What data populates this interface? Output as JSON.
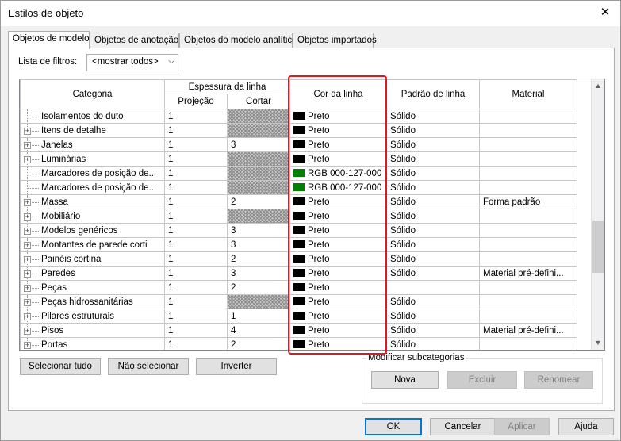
{
  "window": {
    "title": "Estilos de objeto",
    "close_glyph": "✕"
  },
  "tabs": [
    {
      "label": "Objetos de modelo",
      "active": true
    },
    {
      "label": "Objetos de anotação",
      "active": false
    },
    {
      "label": "Objetos do modelo analítico",
      "active": false
    },
    {
      "label": "Objetos importados",
      "active": false
    }
  ],
  "filter": {
    "label": "Lista de filtros:",
    "value": "<mostrar todos>"
  },
  "columns": {
    "category": "Categoria",
    "line_weight": "Espessura da linha",
    "projection": "Projeção",
    "cut": "Cortar",
    "line_color": "Cor da linha",
    "line_pattern": "Padrão de linha",
    "material": "Material"
  },
  "colors": {
    "black": "#000000",
    "green": "#007f00",
    "highlight": "#e4161d"
  },
  "rows": [
    {
      "category": "Isolamentos do duto",
      "expand": false,
      "projection": "1",
      "cut": "",
      "cut_hatched": true,
      "color_label": "Preto",
      "color": "#000000",
      "pattern": "Sólido",
      "material": ""
    },
    {
      "category": "Itens de detalhe",
      "expand": true,
      "projection": "1",
      "cut": "",
      "cut_hatched": true,
      "color_label": "Preto",
      "color": "#000000",
      "pattern": "Sólido",
      "material": ""
    },
    {
      "category": "Janelas",
      "expand": true,
      "projection": "1",
      "cut": "3",
      "cut_hatched": false,
      "color_label": "Preto",
      "color": "#000000",
      "pattern": "Sólido",
      "material": ""
    },
    {
      "category": "Luminárias",
      "expand": true,
      "projection": "1",
      "cut": "",
      "cut_hatched": true,
      "color_label": "Preto",
      "color": "#000000",
      "pattern": "Sólido",
      "material": ""
    },
    {
      "category": "Marcadores de posição de...",
      "expand": false,
      "projection": "1",
      "cut": "",
      "cut_hatched": true,
      "color_label": "RGB 000-127-000",
      "color": "#007f00",
      "pattern": "Sólido",
      "material": ""
    },
    {
      "category": "Marcadores de posição de...",
      "expand": false,
      "projection": "1",
      "cut": "",
      "cut_hatched": true,
      "color_label": "RGB 000-127-000",
      "color": "#007f00",
      "pattern": "Sólido",
      "material": ""
    },
    {
      "category": "Massa",
      "expand": true,
      "projection": "1",
      "cut": "2",
      "cut_hatched": false,
      "color_label": "Preto",
      "color": "#000000",
      "pattern": "Sólido",
      "material": "Forma padrão"
    },
    {
      "category": "Mobiliário",
      "expand": true,
      "projection": "1",
      "cut": "",
      "cut_hatched": true,
      "color_label": "Preto",
      "color": "#000000",
      "pattern": "Sólido",
      "material": ""
    },
    {
      "category": "Modelos genéricos",
      "expand": true,
      "projection": "1",
      "cut": "3",
      "cut_hatched": false,
      "color_label": "Preto",
      "color": "#000000",
      "pattern": "Sólido",
      "material": ""
    },
    {
      "category": "Montantes de parede corti",
      "expand": true,
      "projection": "1",
      "cut": "3",
      "cut_hatched": false,
      "color_label": "Preto",
      "color": "#000000",
      "pattern": "Sólido",
      "material": ""
    },
    {
      "category": "Painéis cortina",
      "expand": true,
      "projection": "1",
      "cut": "2",
      "cut_hatched": false,
      "color_label": "Preto",
      "color": "#000000",
      "pattern": "Sólido",
      "material": ""
    },
    {
      "category": "Paredes",
      "expand": true,
      "projection": "1",
      "cut": "3",
      "cut_hatched": false,
      "color_label": "Preto",
      "color": "#000000",
      "pattern": "Sólido",
      "material": "Material pré-defini..."
    },
    {
      "category": "Peças",
      "expand": true,
      "projection": "1",
      "cut": "2",
      "cut_hatched": false,
      "color_label": "Preto",
      "color": "#000000",
      "pattern": "",
      "material": ""
    },
    {
      "category": "Peças hidrossanitárias",
      "expand": true,
      "projection": "1",
      "cut": "",
      "cut_hatched": true,
      "color_label": "Preto",
      "color": "#000000",
      "pattern": "Sólido",
      "material": ""
    },
    {
      "category": "Pilares estruturais",
      "expand": true,
      "projection": "1",
      "cut": "1",
      "cut_hatched": false,
      "color_label": "Preto",
      "color": "#000000",
      "pattern": "Sólido",
      "material": ""
    },
    {
      "category": "Pisos",
      "expand": true,
      "projection": "1",
      "cut": "4",
      "cut_hatched": false,
      "color_label": "Preto",
      "color": "#000000",
      "pattern": "Sólido",
      "material": "Material pré-defini..."
    },
    {
      "category": "Portas",
      "expand": true,
      "projection": "1",
      "cut": "2",
      "cut_hatched": false,
      "color_label": "Preto",
      "color": "#000000",
      "pattern": "Sólido",
      "material": ""
    }
  ],
  "buttons": {
    "select_all": "Selecionar tudo",
    "select_none": "Não selecionar",
    "invert": "Inverter",
    "ok": "OK",
    "cancel": "Cancelar",
    "apply": "Aplicar",
    "help": "Ajuda"
  },
  "subcategories": {
    "label": "Modificar subcategorias",
    "new": "Nova",
    "delete": "Excluir",
    "rename": "Renomear"
  },
  "icons": {
    "expand": "plus-box-icon",
    "scroll_up": "chevron-up-icon",
    "scroll_down": "chevron-down-icon",
    "dropdown": "chevron-down-icon"
  }
}
